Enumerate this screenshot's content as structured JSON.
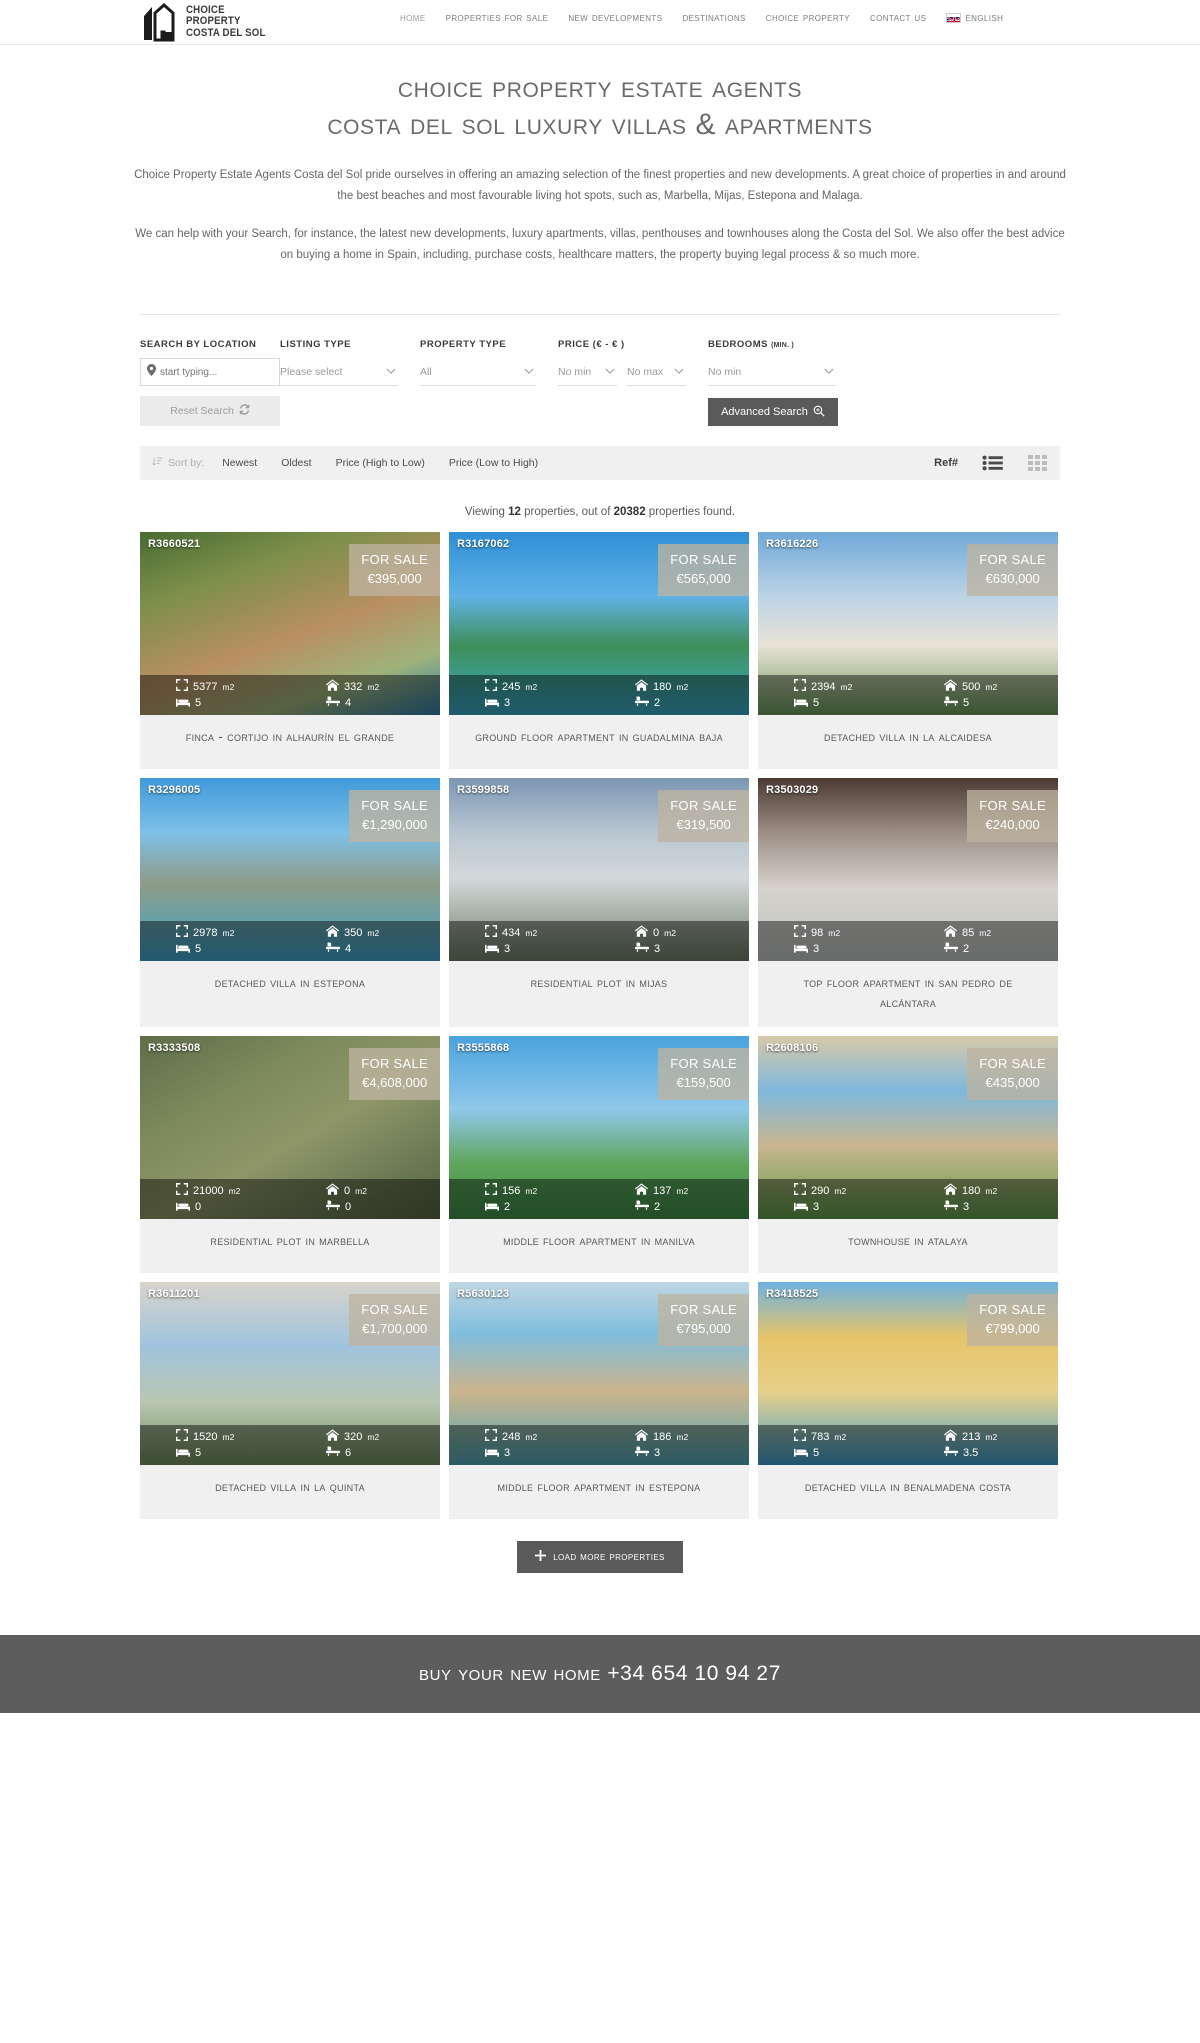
{
  "header": {
    "logo": {
      "line1": "CHOICE",
      "line2": "PROPERTY",
      "line3": "COSTA DEL SOL"
    },
    "nav": [
      {
        "label": "Home",
        "active": true
      },
      {
        "label": "Properties for sale",
        "active": false
      },
      {
        "label": "New Developments",
        "active": false
      },
      {
        "label": "Destinations",
        "active": false
      },
      {
        "label": "Choice Property",
        "active": false
      },
      {
        "label": "Contact us",
        "active": false
      }
    ],
    "language": "English"
  },
  "hero": {
    "title_line1": "Choice Property Estate Agents",
    "title_line2": "Costa del Sol Luxury Villas & apartments"
  },
  "intro": {
    "p1": "Choice Property Estate Agents Costa del Sol pride ourselves in offering an amazing selection of the finest properties and new developments.  A great choice of properties in and around the best beaches and most favourable living hot spots, such as, Marbella, Mijas, Estepona and Malaga.",
    "p2": "We can help with your Search, for instance, the latest new developments, luxury apartments, villas, penthouses and townhouses along the Costa del Sol. We also offer the best advice on buying a home in Spain, including, purchase costs, healthcare matters, the property buying legal process & so much more."
  },
  "search": {
    "location_label": "SEARCH BY LOCATION",
    "location_placeholder": "start typing...",
    "location_value": "",
    "reset_label": "Reset Search",
    "listing_type_label": "LISTING TYPE",
    "listing_type_value": "Please select",
    "property_type_label": "PROPERTY TYPE",
    "property_type_value": "All",
    "price_label": "PRICE (€ - € )",
    "price_min_value": "No min",
    "price_max_value": "No max",
    "bedrooms_label": "BEDROOMS",
    "bedrooms_note": "(MIN. )",
    "bedrooms_value": "No min",
    "advanced_label": "Advanced Search"
  },
  "sortbar": {
    "sort_by_label": "Sort by:",
    "options": [
      "Newest",
      "Oldest",
      "Price (High to Low)",
      "Price (Low to High)"
    ],
    "ref_label": "Ref#"
  },
  "results": {
    "prefix": "Viewing ",
    "viewing_count": "12",
    "middle": " properties, out of ",
    "total_count": "20382",
    "suffix": " properties found."
  },
  "labels": {
    "for_sale": "FOR SALE",
    "unit": "m2",
    "load_more": "Load more properties"
  },
  "properties": [
    {
      "ref": "R3660521",
      "price": "€395,000",
      "plot": "5377",
      "built": "332",
      "beds": "5",
      "baths": "4",
      "title": "Finca - Cortijo in Alhaurín el Grande",
      "photo": "villa-aerial-pool"
    },
    {
      "ref": "R3167062",
      "price": "€565,000",
      "plot": "245",
      "built": "180",
      "beds": "3",
      "baths": "2",
      "title": "Ground Floor Apartment in Guadalmina Baja",
      "photo": "palms-pool-resort"
    },
    {
      "ref": "R3616226",
      "price": "€630,000",
      "plot": "2394",
      "built": "500",
      "beds": "5",
      "baths": "5",
      "title": "Detached Villa in La Alcaidesa",
      "photo": "white-villa-pool"
    },
    {
      "ref": "R3296005",
      "price": "€1,290,000",
      "plot": "2978",
      "built": "350",
      "beds": "5",
      "baths": "4",
      "title": "Detached Villa in Estepona",
      "photo": "terrace-pool-palms"
    },
    {
      "ref": "R3599858",
      "price": "€319,500",
      "plot": "434",
      "built": "0",
      "beds": "3",
      "baths": "3",
      "title": "Residential Plot in Mijas",
      "photo": "mountain-clouds-building"
    },
    {
      "ref": "R3503029",
      "price": "€240,000",
      "plot": "98",
      "built": "85",
      "beds": "3",
      "baths": "2",
      "title": "Top Floor Apartment in San Pedro de Alcántara",
      "photo": "pergola-terrace-sofa"
    },
    {
      "ref": "R3333508",
      "price": "€4,608,000",
      "plot": "21000",
      "built": "0",
      "beds": "0",
      "baths": "0",
      "title": "Residential Plot in Marbella",
      "photo": "satellite-map"
    },
    {
      "ref": "R3555868",
      "price": "€159,500",
      "plot": "156",
      "built": "137",
      "beds": "2",
      "baths": "2",
      "title": "Middle Floor Apartment in Manilva",
      "photo": "lawn-pool-sky"
    },
    {
      "ref": "R2608106",
      "price": "€435,000",
      "plot": "290",
      "built": "180",
      "beds": "3",
      "baths": "3",
      "title": "Townhouse in Atalaya",
      "photo": "garden-parasol-houses"
    },
    {
      "ref": "R3611201",
      "price": "€1,700,000",
      "plot": "1520",
      "built": "320",
      "beds": "5",
      "baths": "6",
      "title": "Detached Villa in La Quinta",
      "photo": "arch-view-valley"
    },
    {
      "ref": "R5630123",
      "price": "€795,000",
      "plot": "248",
      "built": "186",
      "beds": "3",
      "baths": "3",
      "title": "Middle Floor Apartment in Estepona",
      "photo": "resort-lagoon-pool"
    },
    {
      "ref": "R3418525",
      "price": "€799,000",
      "plot": "783",
      "built": "213",
      "beds": "5",
      "baths": "3.5",
      "title": "Detached Villa in Benalmadena Costa",
      "photo": "yellow-villa-pool"
    }
  ],
  "footer": {
    "cta": "Buy your new home +34 654 10 94 27"
  },
  "colors": {
    "accent_dark": "#5a5a5a",
    "badge": "#beb4a0",
    "text": "#585858",
    "sortbar_bg": "#f0f0f0"
  }
}
